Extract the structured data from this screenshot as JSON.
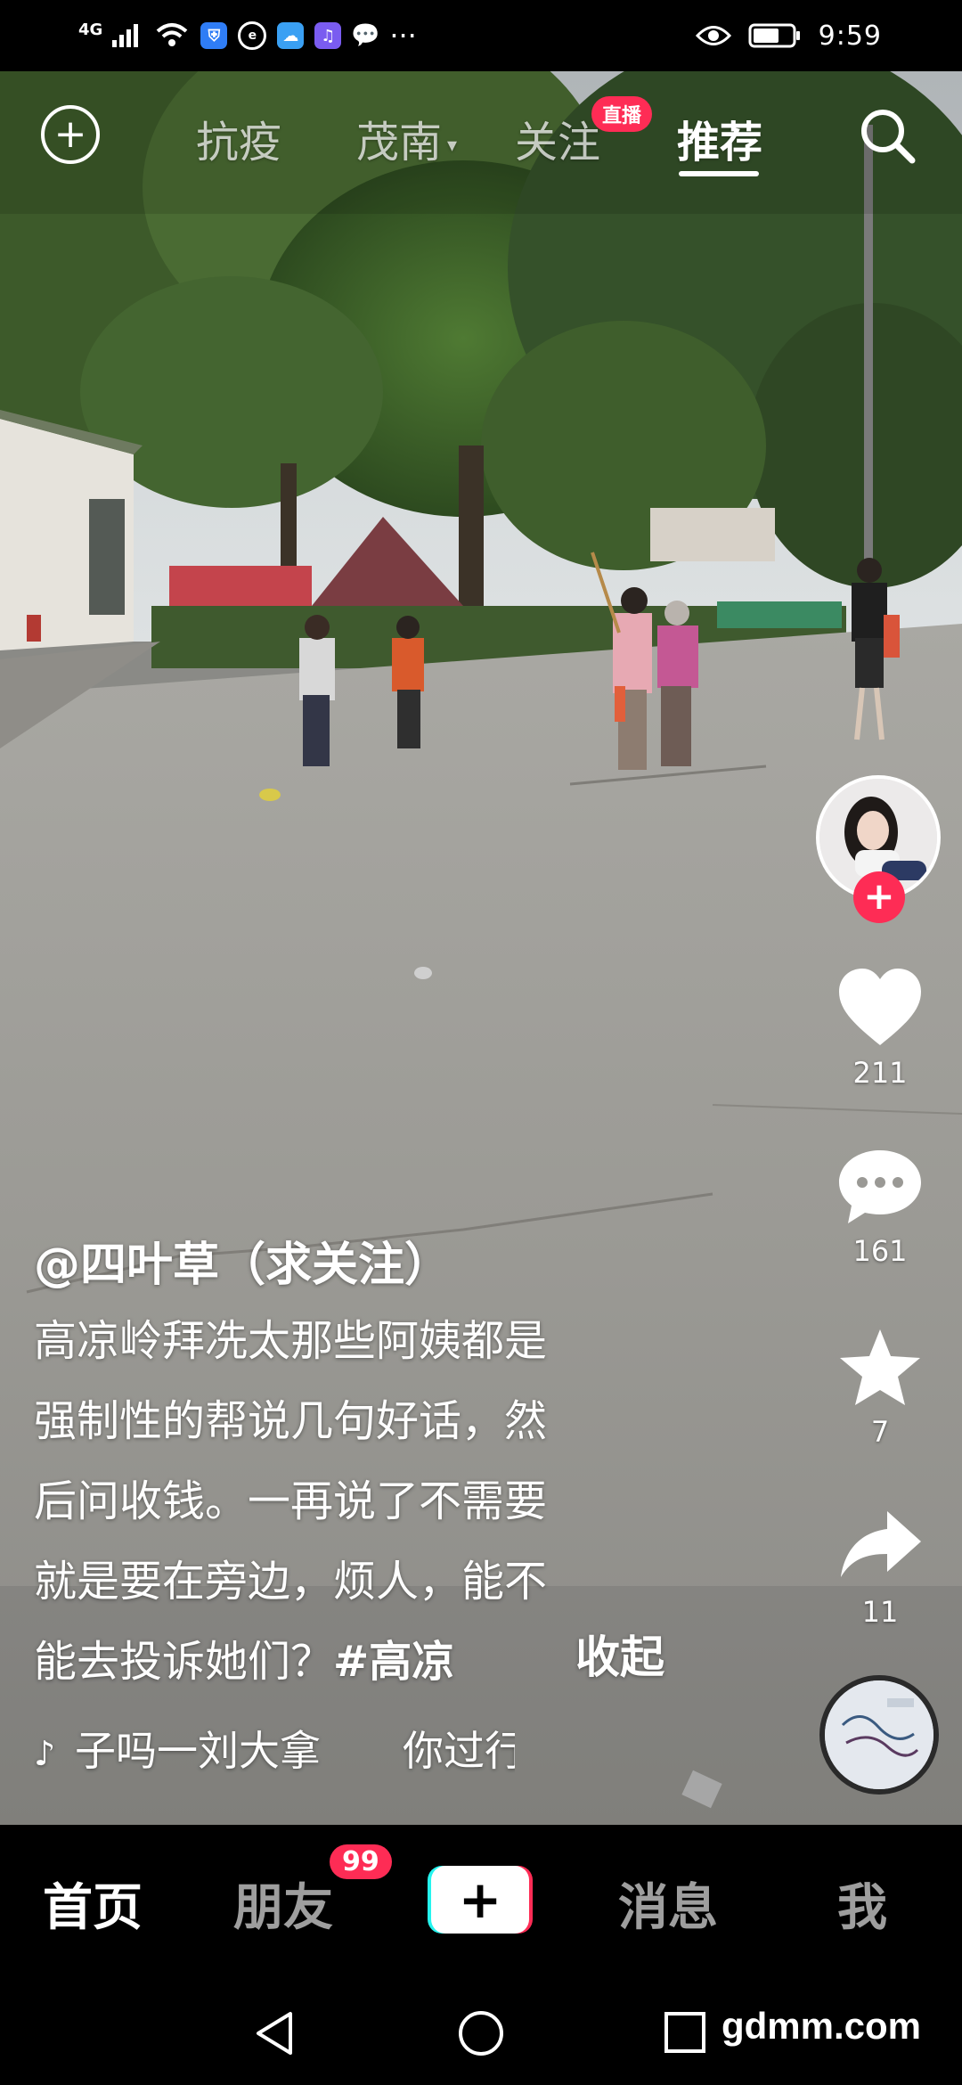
{
  "status_bar": {
    "network": "4G",
    "time": "9:59",
    "more": "···"
  },
  "top_nav": {
    "tabs": [
      {
        "label": "抗疫"
      },
      {
        "label": "茂南"
      },
      {
        "label": "关注"
      },
      {
        "label": "推荐"
      }
    ],
    "live_badge": "直播"
  },
  "actions": {
    "likes": "211",
    "comments": "161",
    "favorites": "7",
    "shares": "11"
  },
  "caption": {
    "author": "@四叶草（求关注）",
    "lines": [
      "高凉岭拜冼太那些阿姨都是",
      "强制性的帮说几句好话，然",
      "后问收钱。一再说了不需要",
      "就是要在旁边，烦人，能不",
      "能去投诉她们？"
    ],
    "hashtag": "#高凉",
    "collapse": "收起"
  },
  "music": {
    "text": "子吗一刘大拿　　你过行"
  },
  "bottom_tabs": {
    "home": "首页",
    "friends": "朋友",
    "friends_badge": "99",
    "create": "+",
    "messages": "消息",
    "me": "我"
  },
  "watermark": "gdmm.com"
}
